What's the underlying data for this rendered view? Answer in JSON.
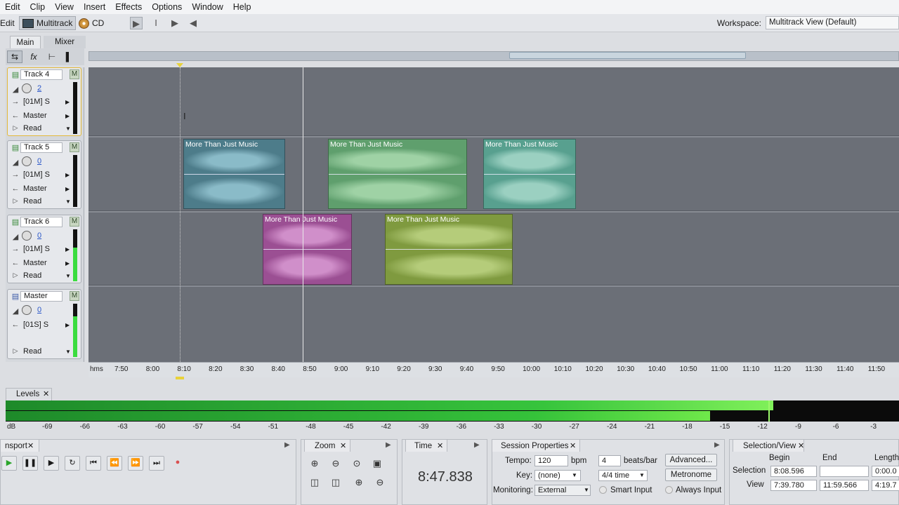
{
  "menu": [
    "Edit",
    "Clip",
    "View",
    "Insert",
    "Effects",
    "Options",
    "Window",
    "Help"
  ],
  "toolbar": {
    "edit_label": "Edit",
    "multitrack_label": "Multitrack",
    "cd_label": "CD",
    "workspace_label": "Workspace:",
    "workspace_value": "Multitrack View (Default)"
  },
  "panel_tabs": {
    "main": "Main",
    "mixer": "Mixer"
  },
  "tracks": [
    {
      "name": "Track 4",
      "volume": "2",
      "input": "[01M] S",
      "output": "Master",
      "automation": "Read",
      "mute": "M"
    },
    {
      "name": "Track 5",
      "volume": "0",
      "input": "[01M] S",
      "output": "Master",
      "automation": "Read",
      "mute": "M"
    },
    {
      "name": "Track 6",
      "volume": "0",
      "input": "[01M] S",
      "output": "Master",
      "automation": "Read",
      "mute": "M"
    },
    {
      "name": "Master",
      "volume": "0",
      "input": "[01S] S",
      "automation": "Read",
      "mute": "M"
    }
  ],
  "clips": [
    {
      "title": "More Than Just Music",
      "color": "#4d7c8a"
    },
    {
      "title": "More Than Just Music",
      "color": "#5f9f6d"
    },
    {
      "title": "More Than Just Music",
      "color": "#58a08f"
    },
    {
      "title": "More Than Just Music",
      "color": "#9b4f93"
    },
    {
      "title": "More Than Just Music",
      "color": "#7f9a3f"
    }
  ],
  "ruler": {
    "unit": "hms",
    "ticks": [
      "7:50",
      "8:00",
      "8:10",
      "8:20",
      "8:30",
      "8:40",
      "8:50",
      "9:00",
      "9:10",
      "9:20",
      "9:30",
      "9:40",
      "9:50",
      "10:00",
      "10:10",
      "10:20",
      "10:30",
      "10:40",
      "10:50",
      "11:00",
      "11:10",
      "11:20",
      "11:30",
      "11:40",
      "11:50"
    ]
  },
  "levels": {
    "tab": "Levels",
    "unit": "dB",
    "scale": [
      "-69",
      "-66",
      "-63",
      "-60",
      "-57",
      "-54",
      "-51",
      "-48",
      "-45",
      "-42",
      "-39",
      "-36",
      "-33",
      "-30",
      "-27",
      "-24",
      "-21",
      "-18",
      "-15",
      "-12",
      "-9",
      "-6",
      "-3"
    ]
  },
  "transport": {
    "tab": "nsport"
  },
  "zoom": {
    "tab": "Zoom"
  },
  "time": {
    "tab": "Time",
    "value": "8:47.838"
  },
  "session": {
    "tab": "Session Properties",
    "tempo_label": "Tempo:",
    "tempo_value": "120",
    "tempo_unit": "bpm",
    "beats_value": "4",
    "beats_unit": "beats/bar",
    "advanced": "Advanced...",
    "key_label": "Key:",
    "key_value": "(none)",
    "time_sig": "4/4 time",
    "metronome": "Metronome",
    "monitoring_label": "Monitoring:",
    "monitoring_value": "External",
    "smart_input": "Smart Input",
    "always_input": "Always Input"
  },
  "selection_view": {
    "tab": "Selection/View",
    "begin_label": "Begin",
    "end_label": "End",
    "length_label": "Length",
    "selection_label": "Selection",
    "view_label": "View",
    "sel_begin": "8:08.596",
    "sel_end": "",
    "sel_length": "0:00.0",
    "view_begin": "7:39.780",
    "view_end": "11:59.566",
    "view_length": "4:19.7"
  }
}
